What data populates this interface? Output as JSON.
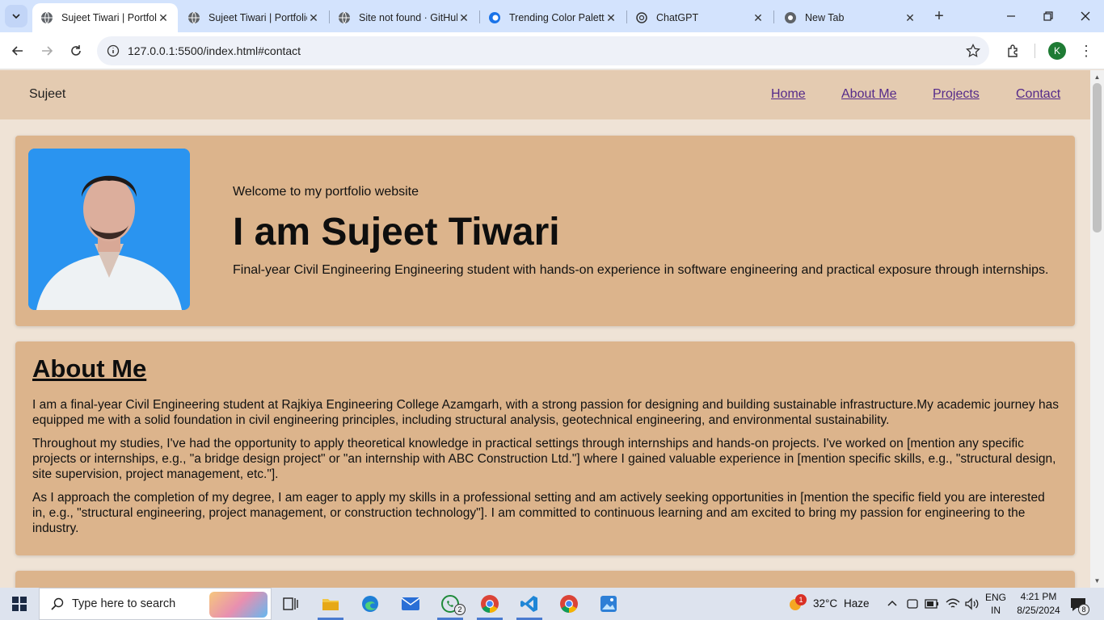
{
  "browser": {
    "tabs": [
      {
        "title": "Sujeet Tiwari | Portfolio",
        "active": true,
        "icon": "globe-icon"
      },
      {
        "title": "Sujeet Tiwari | Portfolio",
        "active": false,
        "icon": "globe-icon"
      },
      {
        "title": "Site not found · GitHub Pages",
        "active": false,
        "icon": "globe-icon"
      },
      {
        "title": "Trending Color Palettes",
        "active": false,
        "icon": "coolors-icon"
      },
      {
        "title": "ChatGPT",
        "active": false,
        "icon": "chatgpt-icon"
      },
      {
        "title": "New Tab",
        "active": false,
        "icon": "chrome-icon"
      }
    ],
    "url": "127.0.0.1:5500/index.html#contact",
    "profile_initial": "K"
  },
  "site": {
    "brand": "Sujeet",
    "nav": [
      "Home",
      "About Me",
      "Projects",
      "Contact"
    ],
    "hero": {
      "welcome": "Welcome to my portfolio website",
      "name": "I am Sujeet Tiwari",
      "description": "Final-year Civil Engineering Engineering student with hands-on experience in software engineering and practical exposure through internships."
    },
    "about": {
      "heading": "About Me",
      "paragraphs": [
        "I am a final-year Civil Engineering student at Rajkiya Engineering College Azamgarh, with a strong passion for designing and building sustainable infrastructure.My academic journey has equipped me with a solid foundation in civil engineering principles, including structural analysis, geotechnical engineering, and environmental sustainability.",
        "Throughout my studies, I've had the opportunity to apply theoretical knowledge in practical settings through internships and hands-on projects. I've worked on [mention any specific projects or internships, e.g., \"a bridge design project\" or \"an internship with ABC Construction Ltd.\"] where I gained valuable experience in [mention specific skills, e.g., \"structural design, site supervision, project management, etc.\"].",
        "As I approach the completion of my degree, I am eager to apply my skills in a professional setting and am actively seeking opportunities in [mention the specific field you are interested in, e.g., \"structural engineering, project management, or construction technology\"]. I am committed to continuous learning and am excited to bring my passion for engineering to the industry."
      ]
    },
    "colors": {
      "nav_bg": "#e4cbb1",
      "card_bg": "#dcb48c",
      "page_bg": "#efe3d6",
      "photo_bg": "#2a94f0",
      "link": "#552a8a"
    }
  },
  "taskbar": {
    "search_placeholder": "Type here to search",
    "whatsapp_badge": "2",
    "weather_alert": "1",
    "temperature": "32°C",
    "weather": "Haze",
    "lang_top": "ENG",
    "lang_bottom": "IN",
    "time": "4:21 PM",
    "date": "8/25/2024",
    "notification_count": "8"
  }
}
